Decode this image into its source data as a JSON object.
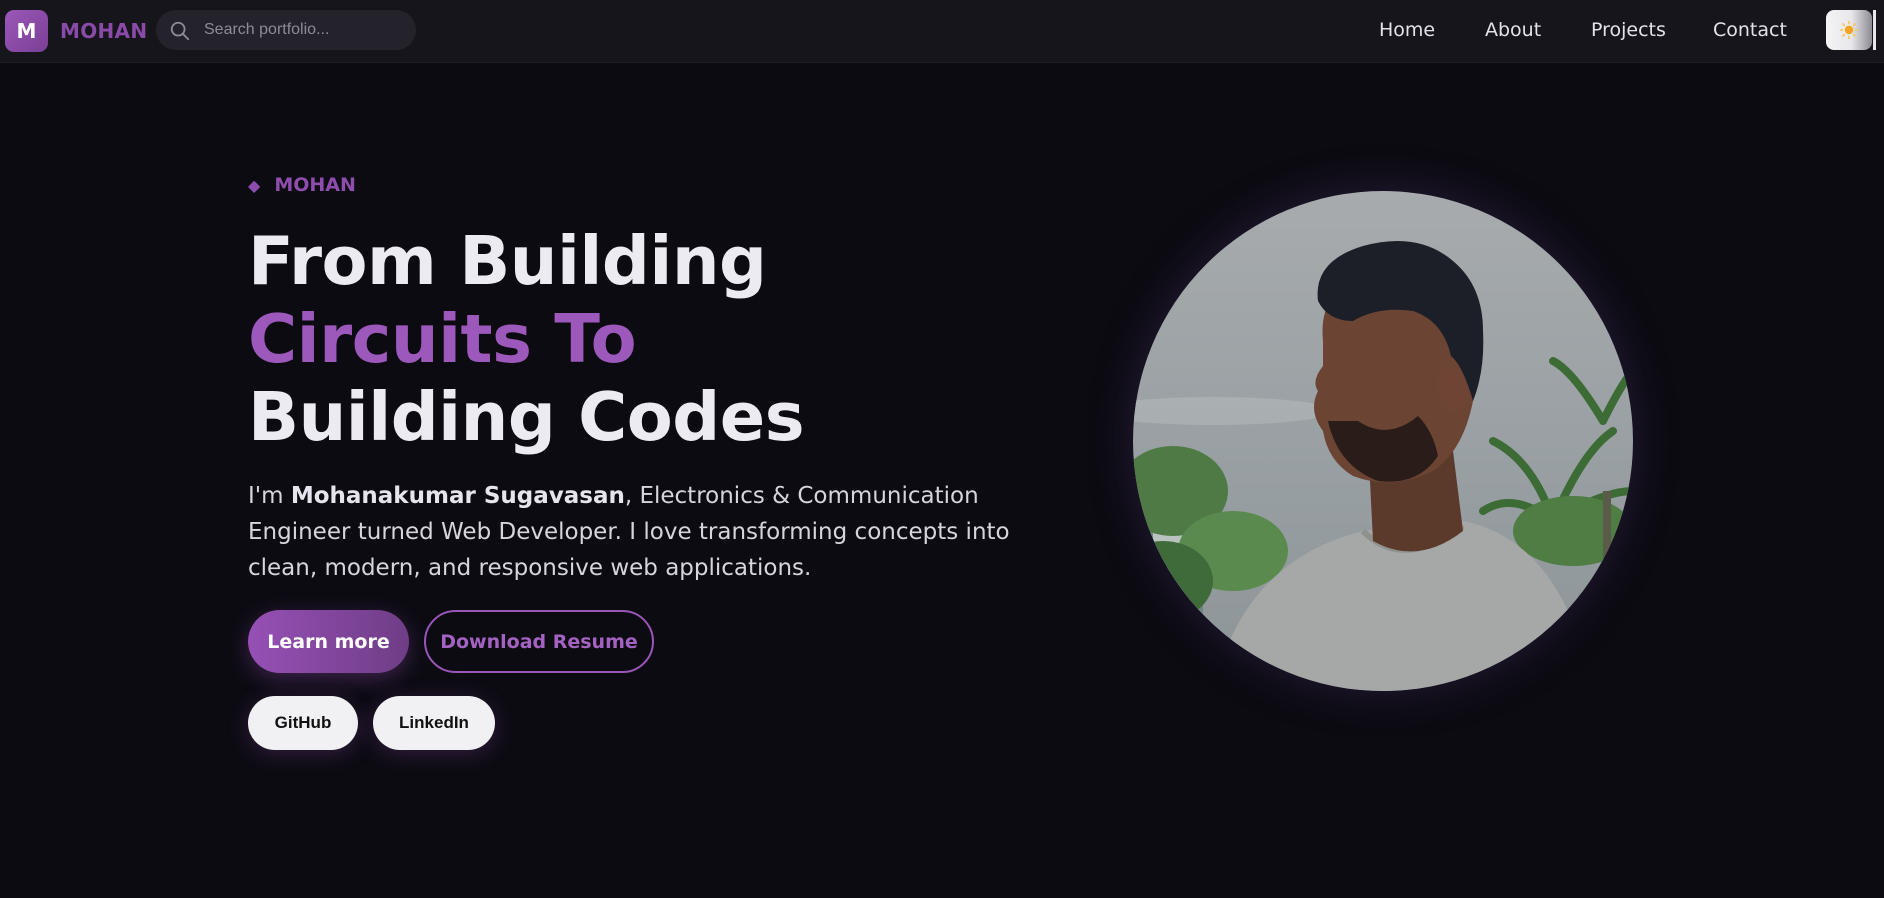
{
  "nav": {
    "logo_letter": "M",
    "brand": "MOHAN",
    "search_placeholder": "Search portfolio...",
    "links": [
      "Home",
      "About",
      "Projects",
      "Contact"
    ]
  },
  "hero": {
    "tag": "MOHAN",
    "headline_line1": "From Building ",
    "headline_accent": "Circuits To",
    "headline_line2": "Building Codes",
    "desc_intro": "I'm ",
    "desc_name": "Mohanakumar Sugavasan",
    "desc_rest": ", Electronics & Communication Engineer turned Web Developer. I love transforming concepts into clean, modern, and responsive web applications.",
    "btn_learn": "Learn more",
    "btn_resume": "Download Resume",
    "btn_github": "GitHub",
    "btn_linkedin": "LinkedIn"
  },
  "colors": {
    "background": "#0c0b12",
    "accent": "#9d58bc",
    "navbar": "#16151b"
  }
}
